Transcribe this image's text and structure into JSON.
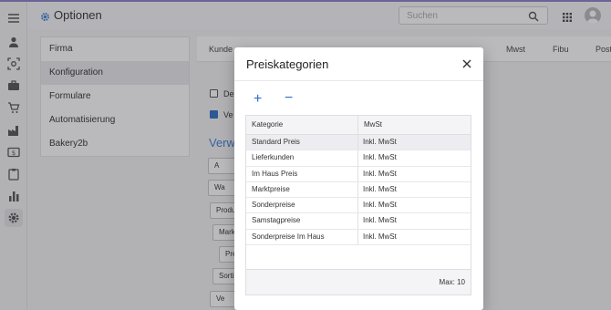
{
  "app": {
    "title": "Optionen",
    "title_icon": "gear-icon"
  },
  "search": {
    "placeholder": "Suchen"
  },
  "rail": {
    "icons": [
      "menu-icon",
      "person-icon",
      "scan-icon",
      "briefcase-icon",
      "cart-icon",
      "factory-icon",
      "money-icon",
      "clipboard-icon",
      "bar-chart-icon",
      "gear-icon"
    ]
  },
  "nav": {
    "items": [
      {
        "label": "Firma"
      },
      {
        "label": "Konfiguration"
      },
      {
        "label": "Formulare"
      },
      {
        "label": "Automatisierung"
      },
      {
        "label": "Bakery2b"
      }
    ]
  },
  "tabs": [
    "Kunde",
    "Mwst",
    "Fibu",
    "Post"
  ],
  "background": {
    "checkbox1_label": "De",
    "checkbox2_label": "Ve",
    "section_title": "Verw",
    "buttons": [
      "A",
      "Wa",
      "Produ",
      "Mark",
      "Pre",
      "Sorti",
      "Ve"
    ]
  },
  "dialog": {
    "title": "Preiskategorien",
    "add_label": "+",
    "remove_label": "−",
    "columns": [
      "Kategorie",
      "MwSt"
    ],
    "rows": [
      {
        "kategorie": "Standard Preis",
        "mwst": "Inkl. MwSt"
      },
      {
        "kategorie": "Lieferkunden",
        "mwst": "Inkl. MwSt"
      },
      {
        "kategorie": "Im Haus Preis",
        "mwst": "Inkl. MwSt"
      },
      {
        "kategorie": "Marktpreise",
        "mwst": "Inkl. MwSt"
      },
      {
        "kategorie": "Sonderpreise",
        "mwst": "Inkl. MwSt"
      },
      {
        "kategorie": "Samstagpreise",
        "mwst": "Inkl. MwSt"
      },
      {
        "kategorie": "Sonderpreise Im Haus",
        "mwst": "Inkl. MwSt"
      }
    ],
    "footer": "Max: 10"
  },
  "colors": {
    "accent": "#2f6fc4",
    "title_blue": "#3c7fd6",
    "topbar": "#8a80c8"
  }
}
